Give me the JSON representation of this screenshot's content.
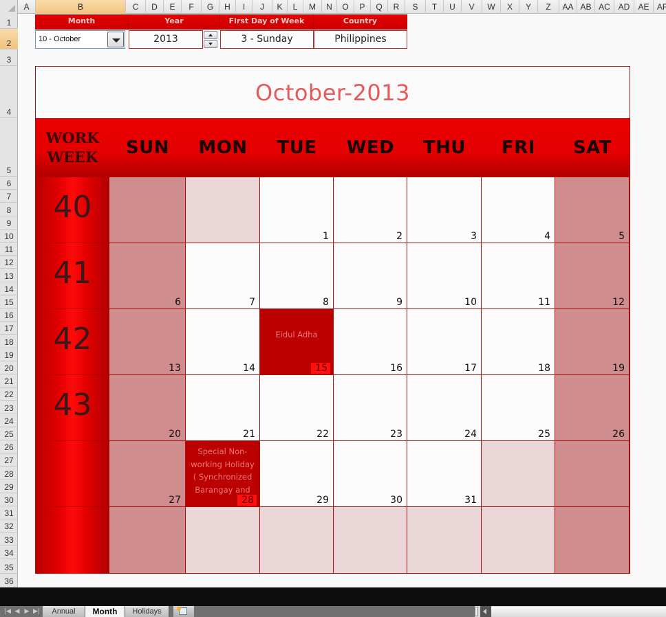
{
  "columns": [
    "A",
    "B",
    "C",
    "D",
    "E",
    "F",
    "G",
    "H",
    "I",
    "J",
    "K",
    "L",
    "M",
    "N",
    "O",
    "P",
    "Q",
    "R",
    "S",
    "T",
    "U",
    "V",
    "W",
    "X",
    "Y",
    "Z",
    "AA",
    "AB",
    "AC",
    "AD",
    "AE",
    "AF"
  ],
  "selected_column": "B",
  "rows": [
    "1",
    "2",
    "3",
    "4",
    "5",
    "6",
    "7",
    "8",
    "9",
    "10",
    "11",
    "12",
    "13",
    "14",
    "15",
    "16",
    "17",
    "18",
    "19",
    "20",
    "21",
    "22",
    "23",
    "24",
    "25",
    "26",
    "27",
    "28",
    "29",
    "30",
    "31",
    "32",
    "33",
    "34",
    "35",
    "36"
  ],
  "selected_row": "2",
  "controls": {
    "month_label": "Month",
    "month_value": "10 - October",
    "year_label": "Year",
    "year_value": "2013",
    "first_day_label": "First Day of Week",
    "first_day_value": "3 - Sunday",
    "country_label": "Country",
    "country_value": "Philippines"
  },
  "calendar": {
    "title": "October-2013",
    "work_week_label_line1": "WORK",
    "work_week_label_line2": "WEEK",
    "day_names": [
      "SUN",
      "MON",
      "TUE",
      "WED",
      "THU",
      "FRI",
      "SAT"
    ],
    "work_weeks": [
      "40",
      "41",
      "42",
      "43",
      "",
      ""
    ],
    "weeks": [
      [
        {
          "day": "",
          "type": "wkend"
        },
        {
          "day": "",
          "type": "blank"
        },
        {
          "day": "1",
          "type": "norm"
        },
        {
          "day": "2",
          "type": "norm"
        },
        {
          "day": "3",
          "type": "norm"
        },
        {
          "day": "4",
          "type": "norm"
        },
        {
          "day": "5",
          "type": "wkend"
        }
      ],
      [
        {
          "day": "6",
          "type": "wkend"
        },
        {
          "day": "7",
          "type": "norm"
        },
        {
          "day": "8",
          "type": "norm"
        },
        {
          "day": "9",
          "type": "norm"
        },
        {
          "day": "10",
          "type": "norm"
        },
        {
          "day": "11",
          "type": "norm"
        },
        {
          "day": "12",
          "type": "wkend"
        }
      ],
      [
        {
          "day": "13",
          "type": "wkend"
        },
        {
          "day": "14",
          "type": "norm"
        },
        {
          "day": "15",
          "type": "hol",
          "holiday": "Eidul Adha"
        },
        {
          "day": "16",
          "type": "norm"
        },
        {
          "day": "17",
          "type": "norm"
        },
        {
          "day": "18",
          "type": "norm"
        },
        {
          "day": "19",
          "type": "wkend"
        }
      ],
      [
        {
          "day": "20",
          "type": "wkend"
        },
        {
          "day": "21",
          "type": "norm"
        },
        {
          "day": "22",
          "type": "norm"
        },
        {
          "day": "23",
          "type": "norm"
        },
        {
          "day": "24",
          "type": "norm"
        },
        {
          "day": "25",
          "type": "norm"
        },
        {
          "day": "26",
          "type": "wkend"
        }
      ],
      [
        {
          "day": "27",
          "type": "wkend"
        },
        {
          "day": "28",
          "type": "hol",
          "holiday": "Special Non-working Holiday ( Synchronized Barangay and"
        },
        {
          "day": "29",
          "type": "norm"
        },
        {
          "day": "30",
          "type": "norm"
        },
        {
          "day": "31",
          "type": "norm"
        },
        {
          "day": "",
          "type": "blank"
        },
        {
          "day": "",
          "type": "wkend"
        }
      ],
      [
        {
          "day": "",
          "type": "wkend"
        },
        {
          "day": "",
          "type": "blank"
        },
        {
          "day": "",
          "type": "blank"
        },
        {
          "day": "",
          "type": "blank"
        },
        {
          "day": "",
          "type": "blank"
        },
        {
          "day": "",
          "type": "blank"
        },
        {
          "day": "",
          "type": "wkend"
        }
      ]
    ]
  },
  "sheet_tabs": [
    {
      "label": "Annual",
      "active": false
    },
    {
      "label": "Month",
      "active": true
    },
    {
      "label": "Holidays",
      "active": false
    }
  ],
  "colors": {
    "accent": "#e00000",
    "title_text": "#e25a5a",
    "weekend_cell": "#d08d8d",
    "blank_cell": "#ead6d6",
    "holiday_cell": "#bb0000"
  }
}
